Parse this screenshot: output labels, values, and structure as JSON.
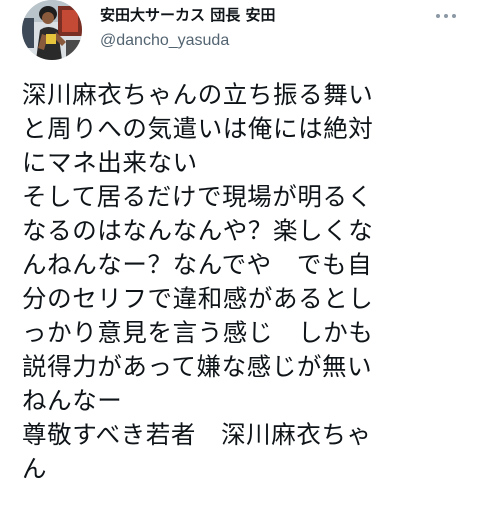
{
  "tweet": {
    "author": {
      "display_name": "安田大サーカス 団長 安田",
      "handle": "@dancho_yasuda",
      "avatar_icon": "profile-photo"
    },
    "more_icon": "more-options-icon",
    "text": "深川麻衣ちゃんの立ち振る舞い\nと周りへの気遣いは俺には絶対\nにマネ出来ない\nそして居るだけで現場が明るく\nなるのはなんなんや？楽しくな\nんねんなー？なんでや　でも自\n分のセリフで違和感があるとし\nっかり意見を言う感じ　しかも\n説得力があって嫌な感じが無い\nねんなー\n尊敬すべき若者　深川麻衣ちゃ\nん"
  },
  "colors": {
    "text_primary": "#0f1419",
    "text_secondary": "#536471",
    "background": "#ffffff"
  }
}
